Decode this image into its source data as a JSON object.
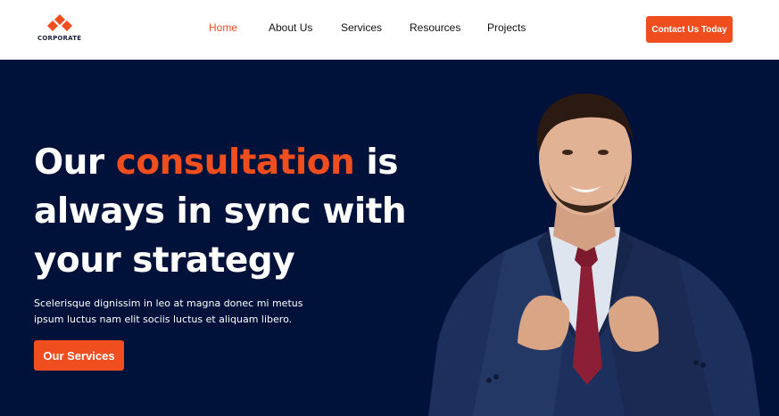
{
  "brand": {
    "name": "CORPORATE",
    "accent_color": "#f04e1e",
    "dark_color": "#01123a"
  },
  "nav": {
    "items": [
      {
        "label": "Home",
        "active": true
      },
      {
        "label": "About Us",
        "active": false
      },
      {
        "label": "Services",
        "active": false
      },
      {
        "label": "Resources",
        "active": false
      },
      {
        "label": "Projects",
        "active": false
      }
    ]
  },
  "header": {
    "cta_label": "Contact Us Today"
  },
  "hero": {
    "title_before": "Our ",
    "title_accent": "consultation",
    "title_after": " is always in sync with your strategy",
    "description": "Scelerisque dignissim in leo at magna donec mi metus ipsum luctus nam elit sociis luctus et aliquam libero.",
    "button_label": "Our Services",
    "image_subject": "smiling businessman in navy suit adjusting red tie"
  }
}
